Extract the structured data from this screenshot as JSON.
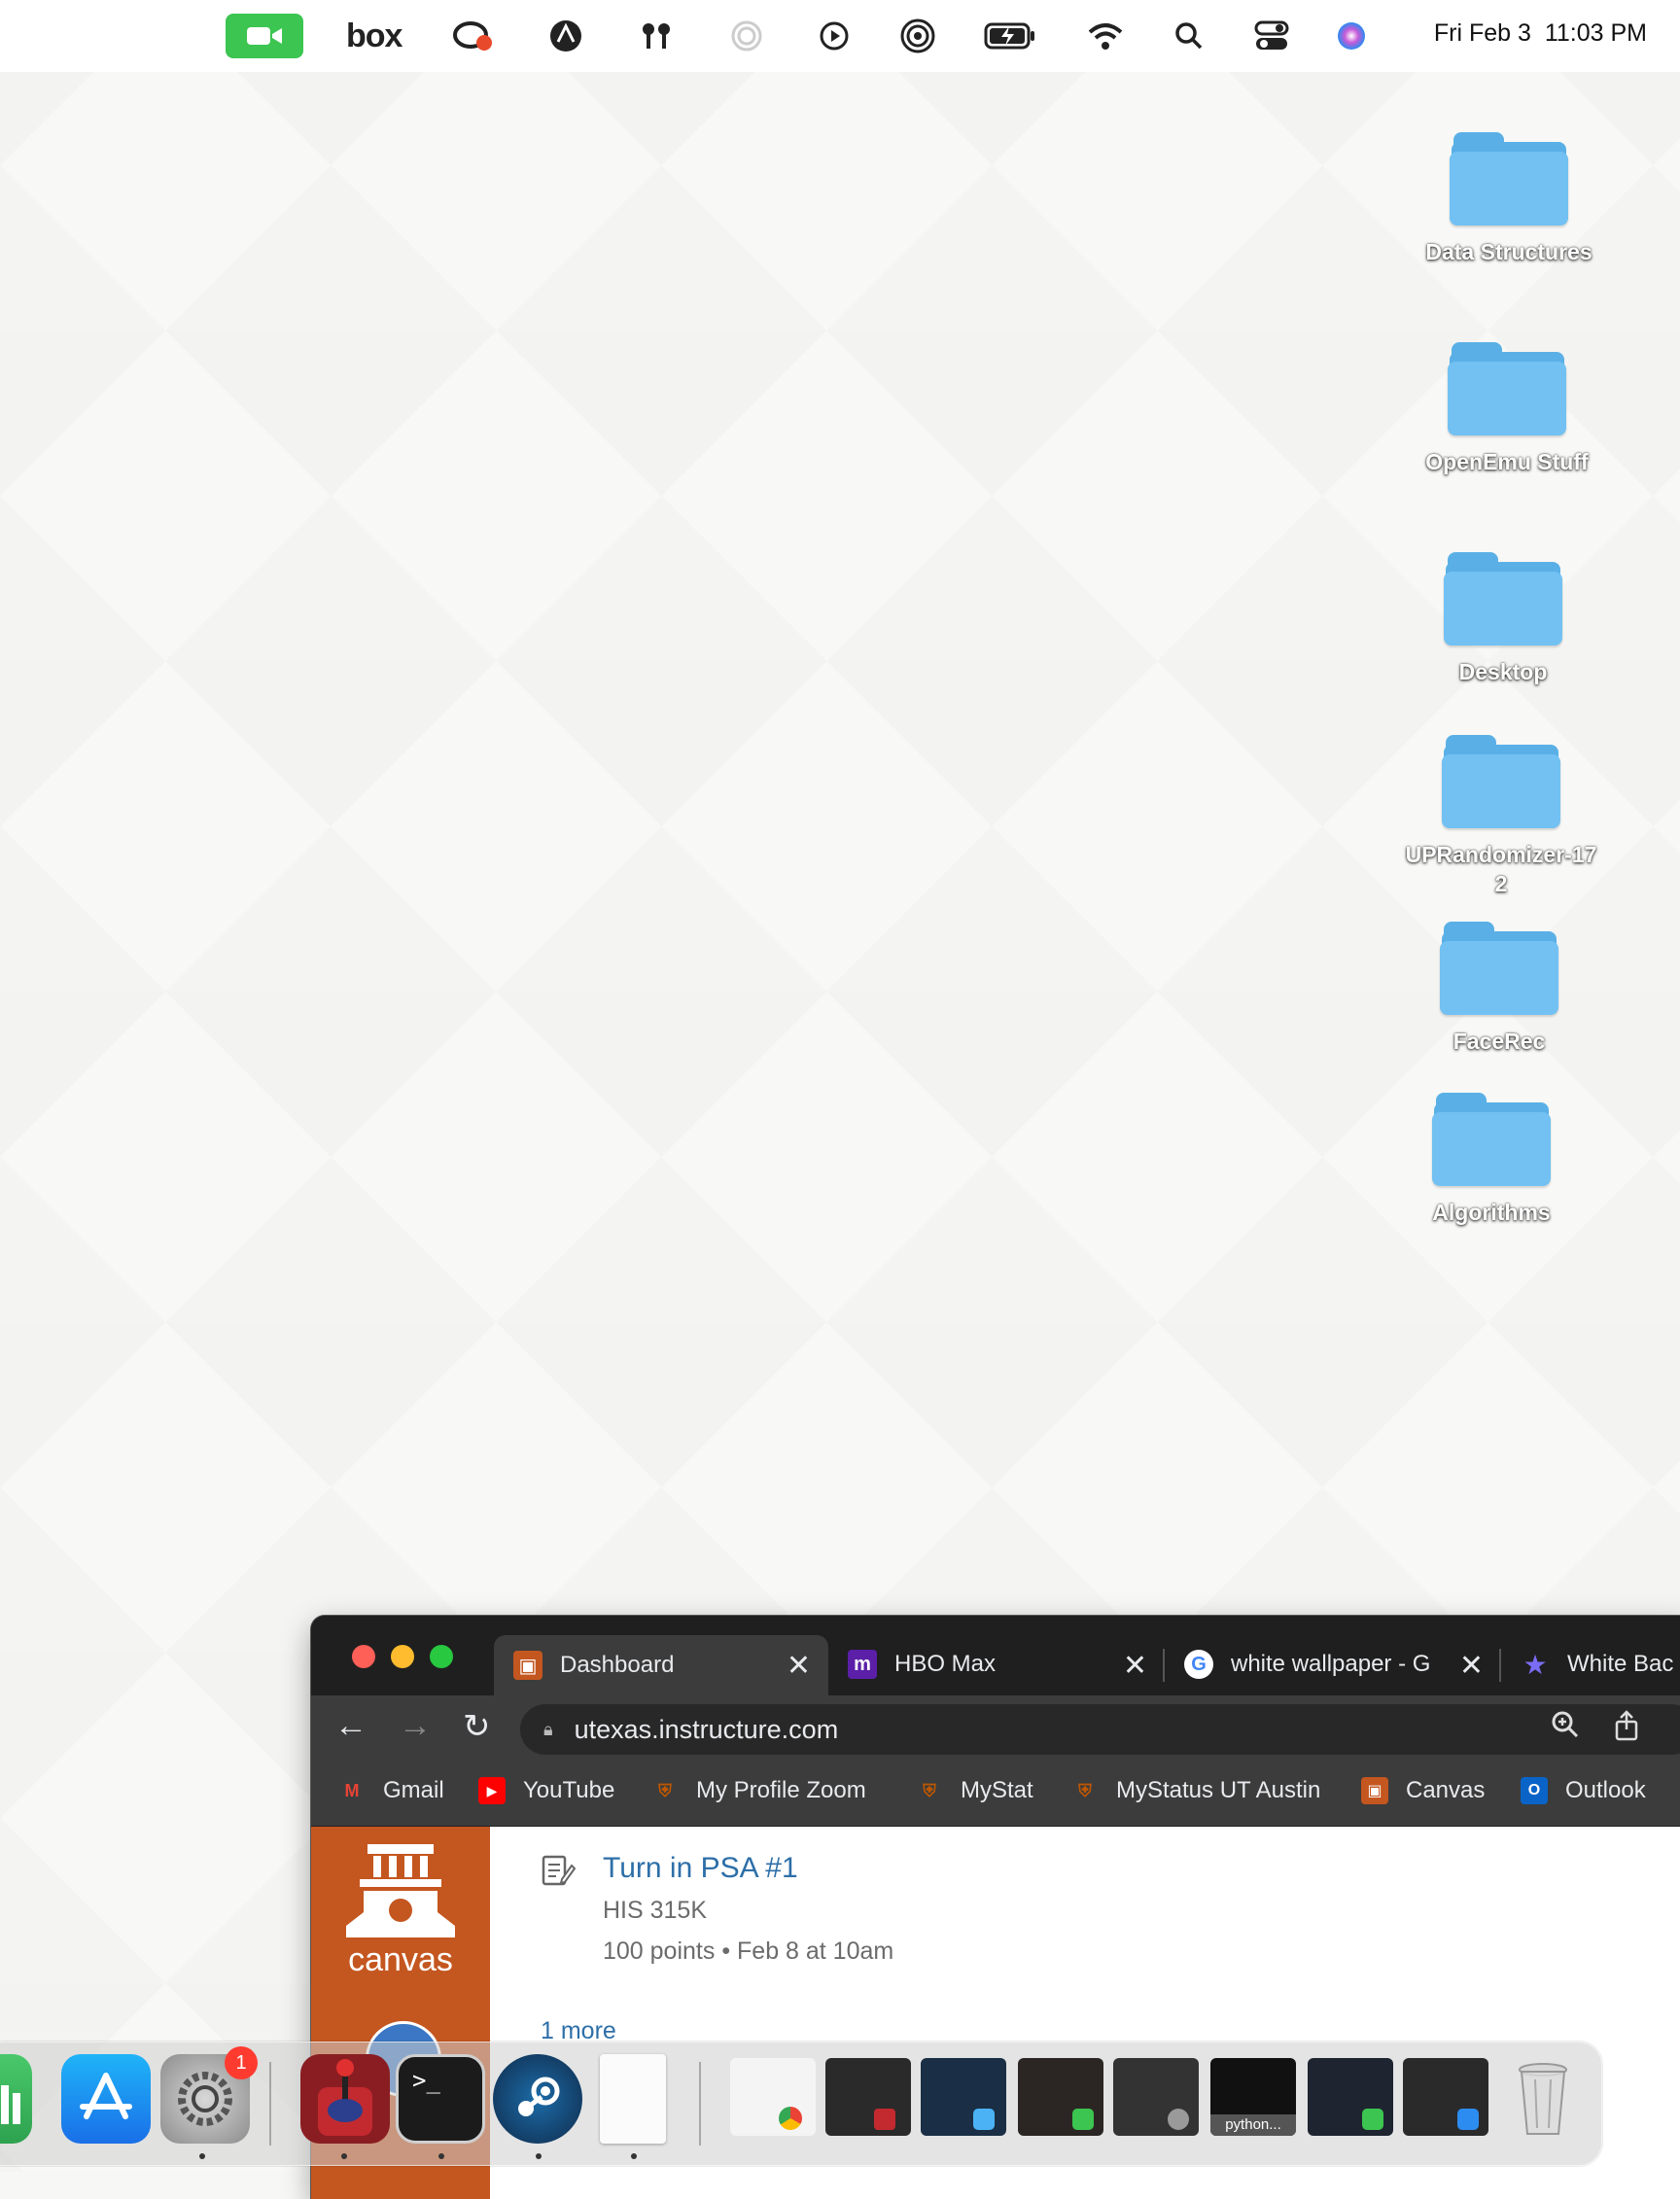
{
  "menubar": {
    "box_label": "box",
    "date": "Fri Feb 3",
    "time": "11:03 PM",
    "icons": [
      "facetime-icon",
      "box-icon",
      "creative-cloud-icon",
      "vpn-icon",
      "airpods-icon",
      "progress-icon",
      "play-icon",
      "airdrop-icon",
      "battery-icon",
      "wifi-icon",
      "search-icon",
      "control-center-icon",
      "siri-icon"
    ]
  },
  "desktop": {
    "folders": [
      {
        "label": "Data Structures"
      },
      {
        "label": "OpenEmu Stuff"
      },
      {
        "label": "Desktop"
      },
      {
        "label": "UPRandomizer-17\n2"
      },
      {
        "label": "FaceRec"
      },
      {
        "label": "Algorithms"
      }
    ]
  },
  "browser": {
    "tabs": [
      {
        "title": "Dashboard",
        "close": "✕"
      },
      {
        "title": "HBO Max",
        "close": "✕"
      },
      {
        "title": "white wallpaper - G",
        "close": "✕"
      },
      {
        "title": "White Bac",
        "close": ""
      }
    ],
    "url": "utexas.instructure.com",
    "bookmarks": [
      "Gmail",
      "YouTube",
      "My Profile Zoom",
      "MyStat",
      "MyStatus UT Austin",
      "Canvas",
      "Outlook"
    ],
    "canvas": {
      "logo_text": "canvas",
      "todo_title": "Turn in PSA #1",
      "todo_course": "HIS 315K",
      "todo_meta": "100 points • Feb 8 at 10am",
      "more_link": "1 more"
    },
    "colors": {
      "canvas_orange": "#c4561f",
      "link_blue": "#2d6fa8"
    }
  },
  "dock": {
    "settings_badge": "1",
    "python_label": "python..."
  }
}
